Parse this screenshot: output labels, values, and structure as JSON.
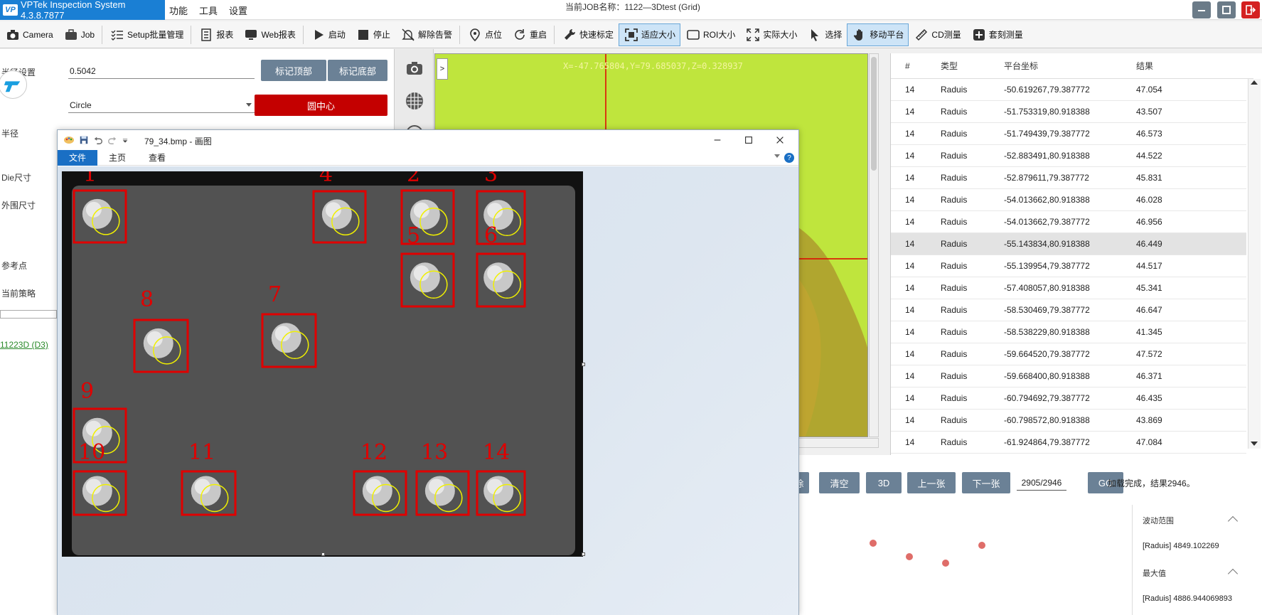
{
  "app": {
    "title": "VPTek Inspection System 4.3.8.7877",
    "logo_text": "VP",
    "menu": [
      "功能",
      "工具",
      "设置"
    ],
    "job_title": "当前JOB名称：1122—3Dtest (Grid)"
  },
  "toolbar": {
    "buttons": [
      {
        "label": "Camera",
        "icon": "camera-icon"
      },
      {
        "label": "Job",
        "icon": "briefcase-icon"
      },
      {
        "label": "Setup批量管理",
        "icon": "checklist-icon"
      },
      {
        "label": "报表",
        "icon": "report-icon"
      },
      {
        "label": "Web报表",
        "icon": "monitor-icon"
      },
      {
        "label": "启动",
        "icon": "play-icon"
      },
      {
        "label": "停止",
        "icon": "stop-icon"
      },
      {
        "label": "解除告警",
        "icon": "bell-off-icon"
      },
      {
        "label": "点位",
        "icon": "map-pin-icon"
      },
      {
        "label": "重启",
        "icon": "restart-icon"
      },
      {
        "label": "快速标定",
        "icon": "wrench-icon"
      },
      {
        "label": "适应大小",
        "icon": "fit-screen-icon"
      },
      {
        "label": "ROI大小",
        "icon": "roi-icon"
      },
      {
        "label": "实际大小",
        "icon": "expand-icon"
      },
      {
        "label": "选择",
        "icon": "cursor-icon"
      },
      {
        "label": "移动平台",
        "icon": "hand-icon"
      },
      {
        "label": "CD测量",
        "icon": "ruler-icon"
      },
      {
        "label": "套刻测量",
        "icon": "plus-icon"
      }
    ],
    "active": [
      "适应大小",
      "移动平台"
    ]
  },
  "left_panel": {
    "label_settings": "半径设置",
    "value_input": "0.5042",
    "btn_mark_top": "标记顶部",
    "btn_mark_bottom": "标记底部",
    "shape_select": "Circle",
    "btn_circle_center": "圆中心",
    "label_radius": "半径",
    "label_die": "Die尺寸",
    "label_outer": "外围尺寸",
    "label_ref": "参考点",
    "label_strategy": "当前策略",
    "link_job": "11223D (D3)"
  },
  "camera": {
    "coords": "X=-47.765804,Y=79.685037,Z=0.328937"
  },
  "results": {
    "headers": [
      "#",
      "类型",
      "平台坐标",
      "结果"
    ],
    "rows": [
      {
        "num": "14",
        "type": "Raduis",
        "coord": "-50.619267,79.387772",
        "result": "47.054"
      },
      {
        "num": "14",
        "type": "Raduis",
        "coord": "-51.753319,80.918388",
        "result": "43.507"
      },
      {
        "num": "14",
        "type": "Raduis",
        "coord": "-51.749439,79.387772",
        "result": "46.573"
      },
      {
        "num": "14",
        "type": "Raduis",
        "coord": "-52.883491,80.918388",
        "result": "44.522"
      },
      {
        "num": "14",
        "type": "Raduis",
        "coord": "-52.879611,79.387772",
        "result": "45.831"
      },
      {
        "num": "14",
        "type": "Raduis",
        "coord": "-54.013662,80.918388",
        "result": "46.028"
      },
      {
        "num": "14",
        "type": "Raduis",
        "coord": "-54.013662,79.387772",
        "result": "46.956"
      },
      {
        "num": "14",
        "type": "Raduis",
        "coord": "-55.143834,80.918388",
        "result": "46.449"
      },
      {
        "num": "14",
        "type": "Raduis",
        "coord": "-55.139954,79.387772",
        "result": "44.517"
      },
      {
        "num": "14",
        "type": "Raduis",
        "coord": "-57.408057,80.918388",
        "result": "45.341"
      },
      {
        "num": "14",
        "type": "Raduis",
        "coord": "-58.530469,79.387772",
        "result": "46.647"
      },
      {
        "num": "14",
        "type": "Raduis",
        "coord": "-58.538229,80.918388",
        "result": "41.345"
      },
      {
        "num": "14",
        "type": "Raduis",
        "coord": "-59.664520,79.387772",
        "result": "47.572"
      },
      {
        "num": "14",
        "type": "Raduis",
        "coord": "-59.668400,80.918388",
        "result": "46.371"
      },
      {
        "num": "14",
        "type": "Raduis",
        "coord": "-60.794692,79.387772",
        "result": "46.435"
      },
      {
        "num": "14",
        "type": "Raduis",
        "coord": "-60.798572,80.918388",
        "result": "43.869"
      },
      {
        "num": "14",
        "type": "Raduis",
        "coord": "-61.924864,79.387772",
        "result": "47.084"
      }
    ],
    "selected_row": 7
  },
  "bottom": {
    "btn_partial": "除",
    "btn_clear": "清空",
    "btn_3d": "3D",
    "btn_prev": "上一张",
    "btn_next": "下一张",
    "page": "2905/2946",
    "btn_go": "GO",
    "status": "加载完成，结果2946。"
  },
  "stats": {
    "range_label": "波动范围",
    "range_value": "[Raduis]    4849.102269",
    "max_label": "最大值",
    "max_value": "[Raduis]    4886.944069893"
  },
  "paint": {
    "title": "79_34.bmp - 画图",
    "tabs": [
      "文件",
      "主页",
      "查看"
    ],
    "help": "?",
    "markers": [
      "1",
      "4",
      "2",
      "3",
      "5",
      "6",
      "8",
      "7",
      "9",
      "10",
      "11",
      "12",
      "13",
      "14"
    ]
  },
  "colors": {
    "accent": "#1a7fd4",
    "button": "#6b8196",
    "danger": "#c40000",
    "camera_bg": "#bfe53d",
    "marker": "#e00000",
    "fit_circle": "#f0f000"
  }
}
